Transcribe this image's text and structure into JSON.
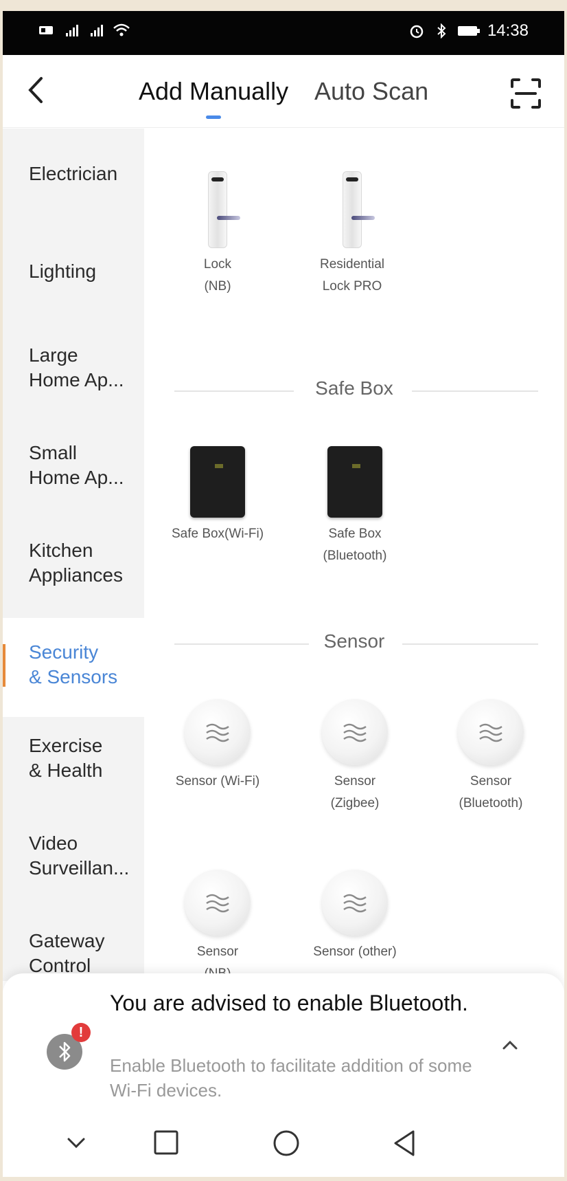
{
  "status_bar": {
    "time": "14:38",
    "left_icons": [
      "hd-icon",
      "signal-icon",
      "signal-icon",
      "wifi-icon"
    ],
    "right_icons": [
      "alarm-icon",
      "bluetooth-icon",
      "battery-icon"
    ]
  },
  "header": {
    "tabs": [
      {
        "label": "Add Manually",
        "active": true
      },
      {
        "label": "Auto Scan",
        "active": false
      }
    ],
    "back_icon": "chevron-left-icon",
    "scan_icon": "scan-icon",
    "accent_color": "#4a8ae8"
  },
  "sidebar": {
    "items": [
      {
        "label": "Electrician"
      },
      {
        "label": "Lighting"
      },
      {
        "label": "Large\nHome Ap..."
      },
      {
        "label": "Small\nHome Ap..."
      },
      {
        "label": "Kitchen\nAppliances"
      },
      {
        "label": "Security\n& Sensors",
        "active": true
      },
      {
        "label": "Exercise\n& Health"
      },
      {
        "label": "Video\nSurveillan..."
      },
      {
        "label": "Gateway\nControl"
      }
    ],
    "active_color": "#4a86d6",
    "indicator_color": "#e68a3a"
  },
  "content": {
    "locks": [
      {
        "label": "Lock\n(NB)",
        "icon": "door-lock-icon"
      },
      {
        "label": "Residential\nLock PRO",
        "icon": "door-lock-icon"
      }
    ],
    "safe_box_section": {
      "title": "Safe Box",
      "items": [
        {
          "label": "Safe Box(Wi-Fi)",
          "icon": "safe-box-icon"
        },
        {
          "label": "Safe Box\n(Bluetooth)",
          "icon": "safe-box-icon"
        }
      ]
    },
    "sensor_section": {
      "title": "Sensor",
      "items": [
        {
          "label": "Sensor (Wi-Fi)",
          "icon": "sensor-icon"
        },
        {
          "label": "Sensor\n(Zigbee)",
          "icon": "sensor-icon"
        },
        {
          "label": "Sensor\n(Bluetooth)",
          "icon": "sensor-icon"
        },
        {
          "label": "Sensor\n(NB)",
          "icon": "sensor-icon"
        },
        {
          "label": "Sensor (other)",
          "icon": "sensor-icon"
        }
      ]
    }
  },
  "notice": {
    "title": "You are advised to enable Bluetooth.",
    "body": "Enable Bluetooth to facilitate addition of some Wi-Fi devices.",
    "badge": "!",
    "icon": "bluetooth-icon",
    "expand_icon": "chevron-up-icon"
  },
  "nav_bar": {
    "buttons": [
      "chevron-down-icon",
      "recent-apps-icon",
      "home-icon",
      "back-icon"
    ]
  }
}
